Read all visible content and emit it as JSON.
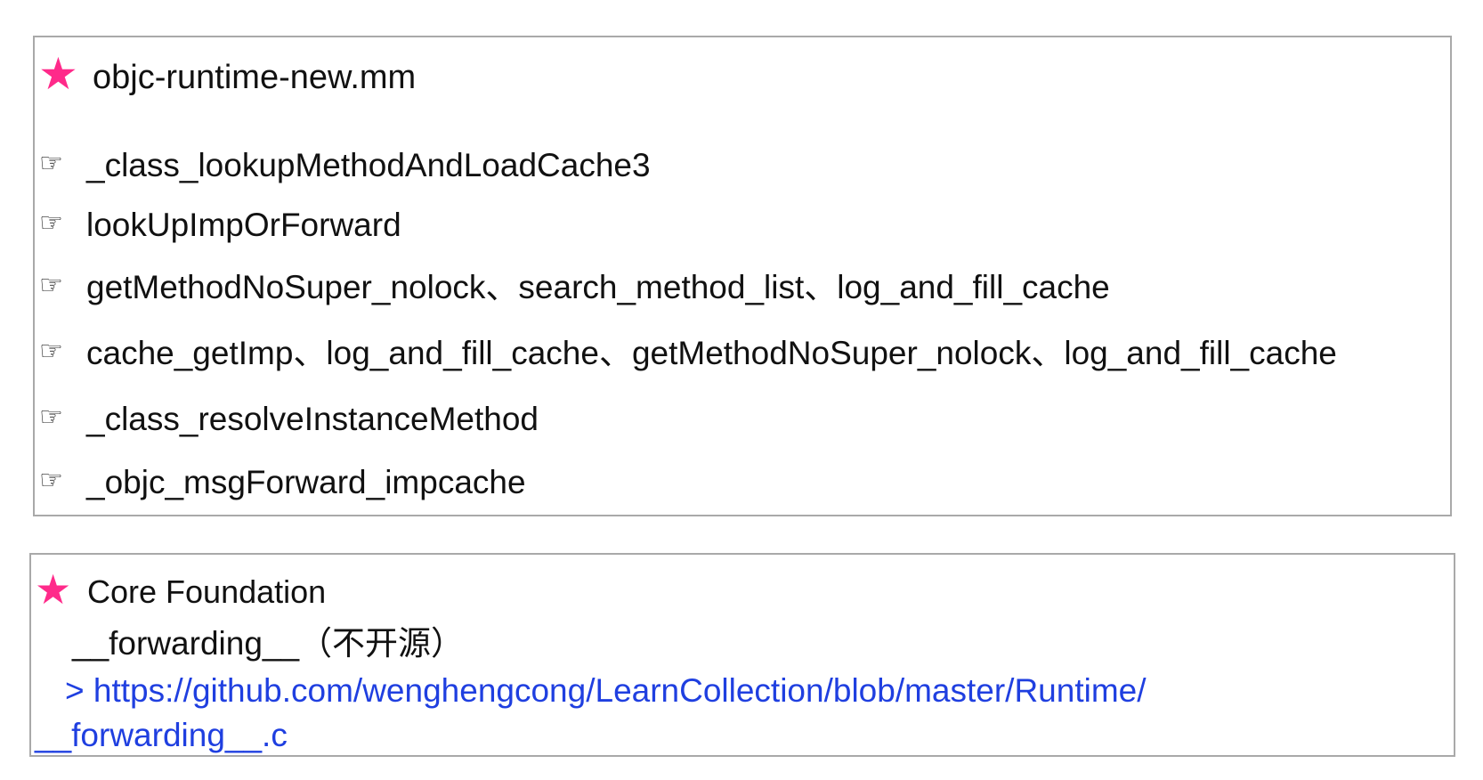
{
  "section1": {
    "star_icon": "star-icon",
    "title": "objc-runtime-new.mm",
    "items": [
      {
        "icon": "pointing-hand-icon",
        "text": "_class_lookupMethodAndLoadCache3"
      },
      {
        "icon": "pointing-hand-icon",
        "text": "lookUpImpOrForward"
      },
      {
        "icon": "pointing-hand-icon",
        "text": "getMethodNoSuper_nolock、search_method_list、log_and_fill_cache"
      },
      {
        "icon": "pointing-hand-icon",
        "text": "cache_getImp、log_and_fill_cache、getMethodNoSuper_nolock、log_and_fill_cache"
      },
      {
        "icon": "pointing-hand-icon",
        "text": "_class_resolveInstanceMethod"
      },
      {
        "icon": "pointing-hand-icon",
        "text": "_objc_msgForward_impcache"
      }
    ]
  },
  "section2": {
    "star_icon": "star-icon",
    "title": "Core Foundation",
    "line1": "__forwarding__（不开源）",
    "link_line1": "> https://github.com/wenghengcong/LearnCollection/blob/master/Runtime/",
    "link_line2": "__forwarding__.c"
  },
  "colors": {
    "star": "#ff2a8a",
    "link": "#1f3fe0",
    "border": "#a9a9a9"
  }
}
